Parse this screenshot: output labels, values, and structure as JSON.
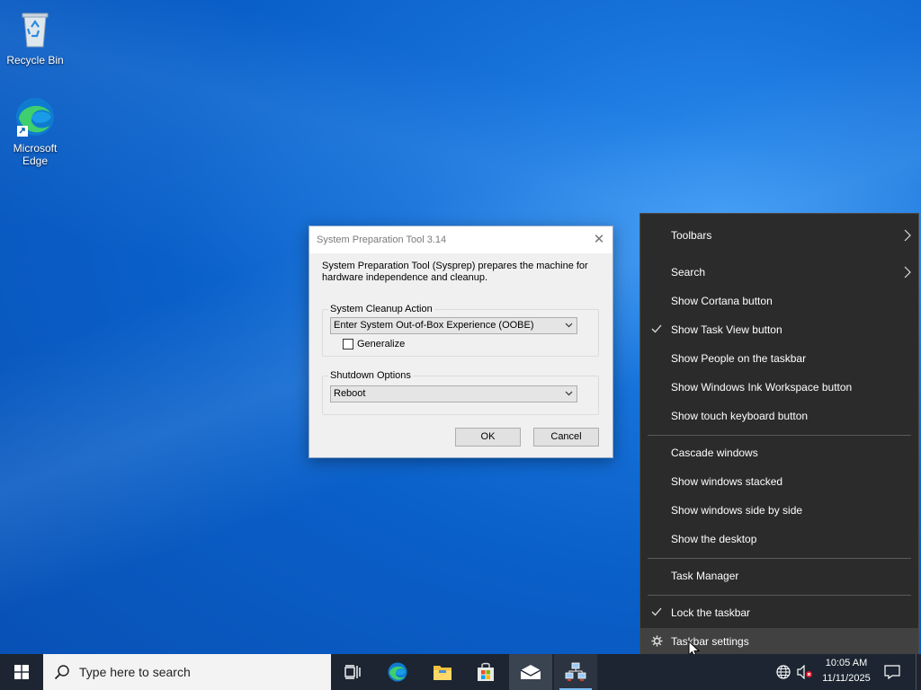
{
  "desktop": {
    "icons": [
      {
        "label": "Recycle Bin",
        "icon": "recycle-bin-icon"
      },
      {
        "label": "Microsoft Edge",
        "icon": "edge-icon"
      }
    ]
  },
  "dialog": {
    "title": "System Preparation Tool 3.14",
    "description": "System Preparation Tool (Sysprep) prepares the machine for hardware independence and cleanup.",
    "cleanup_group_label": "System Cleanup Action",
    "cleanup_value": "Enter System Out-of-Box Experience (OOBE)",
    "generalize_label": "Generalize",
    "generalize_checked": false,
    "shutdown_group_label": "Shutdown Options",
    "shutdown_value": "Reboot",
    "ok_label": "OK",
    "cancel_label": "Cancel"
  },
  "context_menu": {
    "items": [
      {
        "label": "Toolbars",
        "submenu": true
      },
      {
        "label": "Search",
        "submenu": true
      },
      {
        "label": "Show Cortana button"
      },
      {
        "label": "Show Task View button",
        "checked": true
      },
      {
        "label": "Show People on the taskbar"
      },
      {
        "label": "Show Windows Ink Workspace button"
      },
      {
        "label": "Show touch keyboard button"
      },
      {
        "label": "Cascade windows"
      },
      {
        "label": "Show windows stacked"
      },
      {
        "label": "Show windows side by side"
      },
      {
        "label": "Show the desktop"
      },
      {
        "label": "Task Manager"
      },
      {
        "label": "Lock the taskbar",
        "checked": true
      },
      {
        "label": "Taskbar settings",
        "icon": "gear-icon",
        "highlighted": true
      }
    ]
  },
  "taskbar": {
    "search_placeholder": "Type here to search",
    "clock_time": "10:05 AM",
    "clock_date": "11/11/2025",
    "accent_color": "#76b9ed"
  }
}
